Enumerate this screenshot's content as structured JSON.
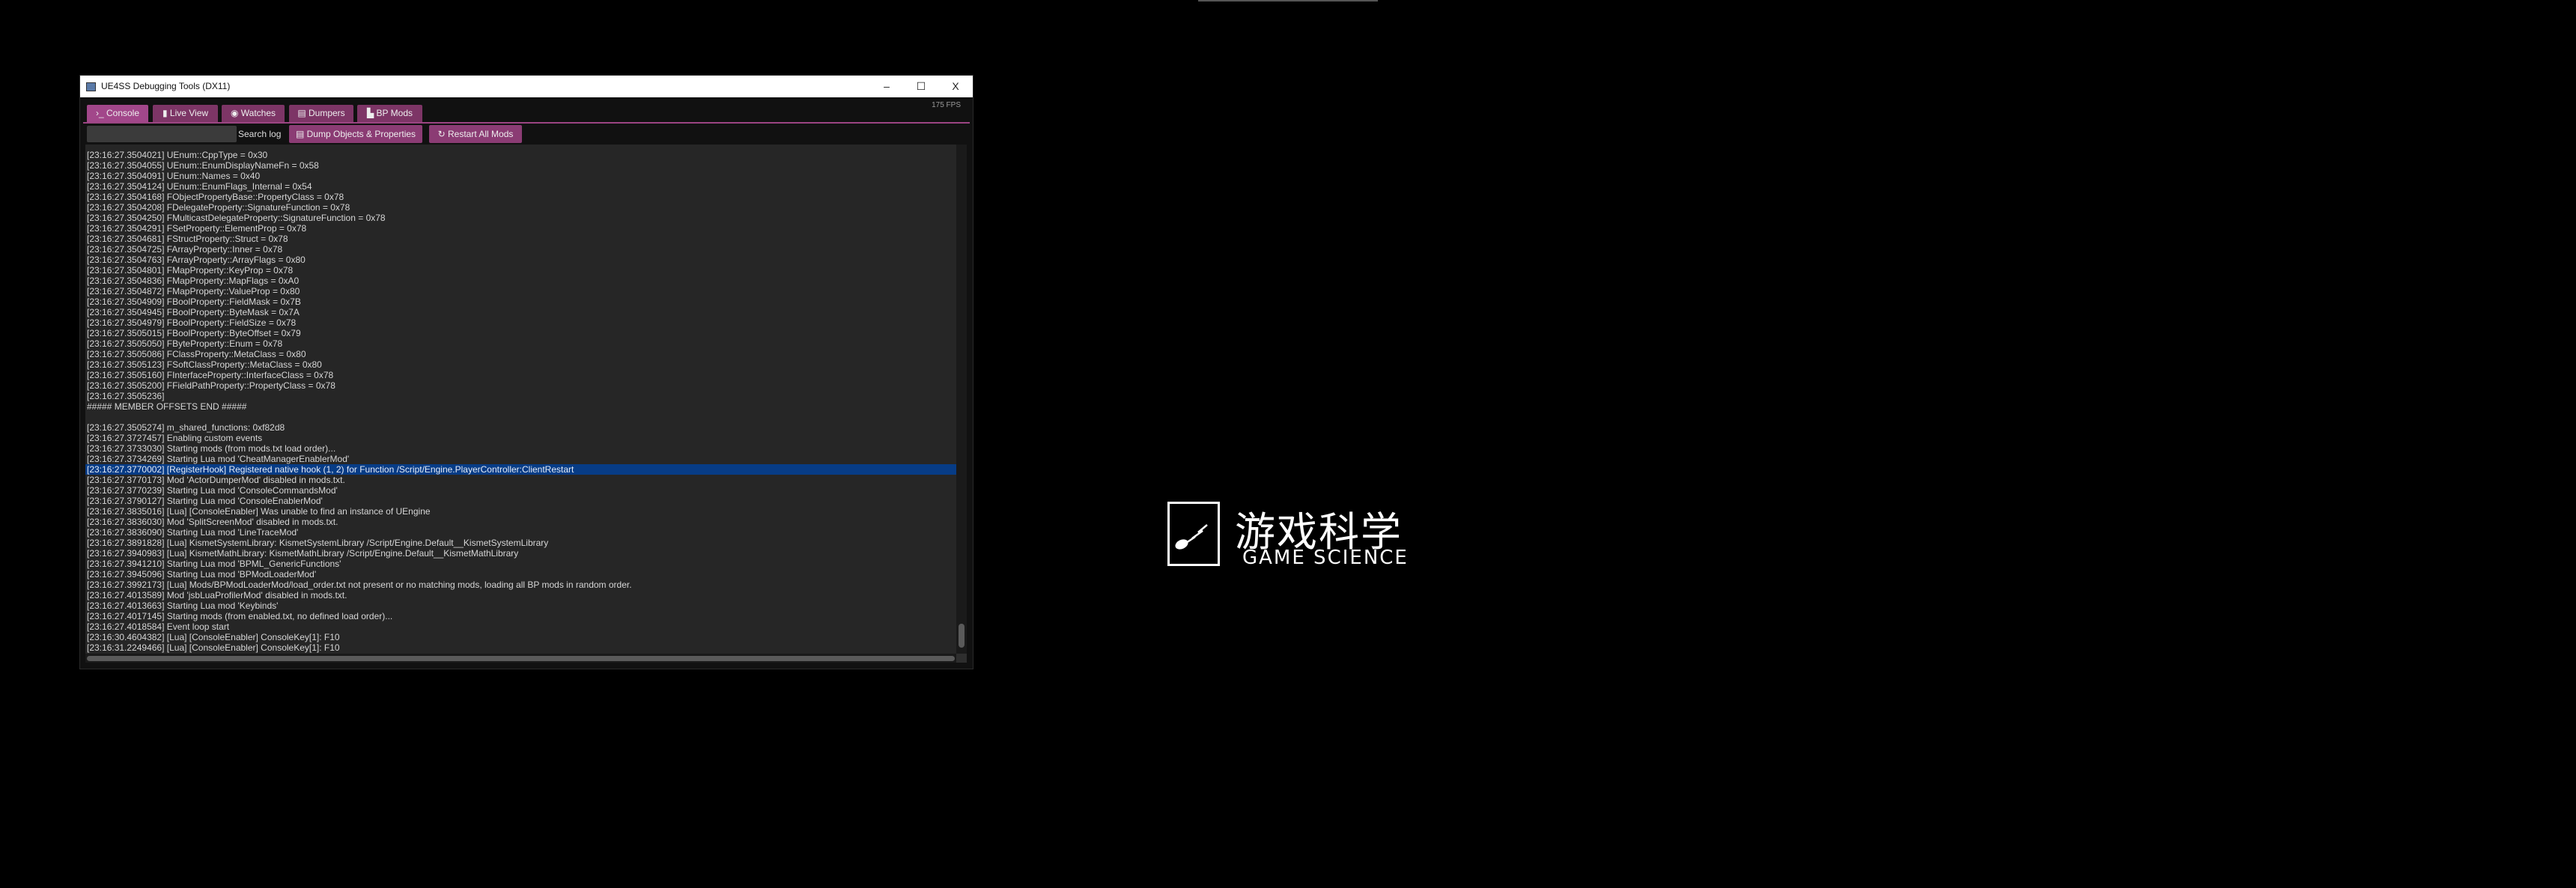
{
  "window": {
    "title": "UE4SS Debugging Tools (DX11)",
    "minimize": "–",
    "maximize": "☐",
    "close": "X"
  },
  "fps": "175 FPS",
  "tabs": [
    {
      "label": "›_ Console",
      "active": true
    },
    {
      "label": "▮ Live View"
    },
    {
      "label": "◉ Watches"
    },
    {
      "label": "▤ Dumpers"
    },
    {
      "label": "▙ BP Mods"
    }
  ],
  "toolbar": {
    "search_value": "",
    "search_label": "Search log",
    "dump_label": "▤ Dump Objects & Properties",
    "restart_label": "↻ Restart All Mods"
  },
  "colors": {
    "accent": "#a2478a",
    "tab": "#7d3566",
    "highlight": "#073c86",
    "log_bg": "#262626"
  },
  "log": [
    "[23:16:27.3504021] UEnum::CppType = 0x30",
    "[23:16:27.3504055] UEnum::EnumDisplayNameFn = 0x58",
    "[23:16:27.3504091] UEnum::Names = 0x40",
    "[23:16:27.3504124] UEnum::EnumFlags_Internal = 0x54",
    "[23:16:27.3504168] FObjectPropertyBase::PropertyClass = 0x78",
    "[23:16:27.3504208] FDelegateProperty::SignatureFunction = 0x78",
    "[23:16:27.3504250] FMulticastDelegateProperty::SignatureFunction = 0x78",
    "[23:16:27.3504291] FSetProperty::ElementProp = 0x78",
    "[23:16:27.3504681] FStructProperty::Struct = 0x78",
    "[23:16:27.3504725] FArrayProperty::Inner = 0x78",
    "[23:16:27.3504763] FArrayProperty::ArrayFlags = 0x80",
    "[23:16:27.3504801] FMapProperty::KeyProp = 0x78",
    "[23:16:27.3504836] FMapProperty::MapFlags = 0xA0",
    "[23:16:27.3504872] FMapProperty::ValueProp = 0x80",
    "[23:16:27.3504909] FBoolProperty::FieldMask = 0x7B",
    "[23:16:27.3504945] FBoolProperty::ByteMask = 0x7A",
    "[23:16:27.3504979] FBoolProperty::FieldSize = 0x78",
    "[23:16:27.3505015] FBoolProperty::ByteOffset = 0x79",
    "[23:16:27.3505050] FByteProperty::Enum = 0x78",
    "[23:16:27.3505086] FClassProperty::MetaClass = 0x80",
    "[23:16:27.3505123] FSoftClassProperty::MetaClass = 0x80",
    "[23:16:27.3505160] FInterfaceProperty::InterfaceClass = 0x78",
    "[23:16:27.3505200] FFieldPathProperty::PropertyClass = 0x78",
    "[23:16:27.3505236]",
    "##### MEMBER OFFSETS END #####",
    "",
    "[23:16:27.3505274] m_shared_functions: 0xf82d8",
    "[23:16:27.3727457] Enabling custom events",
    "[23:16:27.3733030] Starting mods (from mods.txt load order)...",
    "[23:16:27.3734269] Starting Lua mod 'CheatManagerEnablerMod'",
    "[23:16:27.3770002] [RegisterHook] Registered native hook (1, 2) for Function /Script/Engine.PlayerController:ClientRestart",
    "[23:16:27.3770173] Mod 'ActorDumperMod' disabled in mods.txt.",
    "[23:16:27.3770239] Starting Lua mod 'ConsoleCommandsMod'",
    "[23:16:27.3790127] Starting Lua mod 'ConsoleEnablerMod'",
    "[23:16:27.3835016] [Lua] [ConsoleEnabler] Was unable to find an instance of UEngine",
    "[23:16:27.3836030] Mod 'SplitScreenMod' disabled in mods.txt.",
    "[23:16:27.3836090] Starting Lua mod 'LineTraceMod'",
    "[23:16:27.3891828] [Lua] KismetSystemLibrary: KismetSystemLibrary /Script/Engine.Default__KismetSystemLibrary",
    "[23:16:27.3940983] [Lua] KismetMathLibrary: KismetMathLibrary /Script/Engine.Default__KismetMathLibrary",
    "[23:16:27.3941210] Starting Lua mod 'BPML_GenericFunctions'",
    "[23:16:27.3945096] Starting Lua mod 'BPModLoaderMod'",
    "[23:16:27.3992173] [Lua] Mods/BPModLoaderMod/load_order.txt not present or no matching mods, loading all BP mods in random order.",
    "[23:16:27.4013589] Mod 'jsbLuaProfilerMod' disabled in mods.txt.",
    "[23:16:27.4013663] Starting Lua mod 'Keybinds'",
    "[23:16:27.4017145] Starting mods (from enabled.txt, no defined load order)...",
    "[23:16:27.4018584] Event loop start",
    "[23:16:30.4604382] [Lua] [ConsoleEnabler] ConsoleKey[1]: F10",
    "[23:16:31.2249466] [Lua] [ConsoleEnabler] ConsoleKey[1]: F10"
  ],
  "highlighted_line": 30,
  "logo": {
    "cn": "游戏科学",
    "en": "GAME SCIENCE"
  }
}
